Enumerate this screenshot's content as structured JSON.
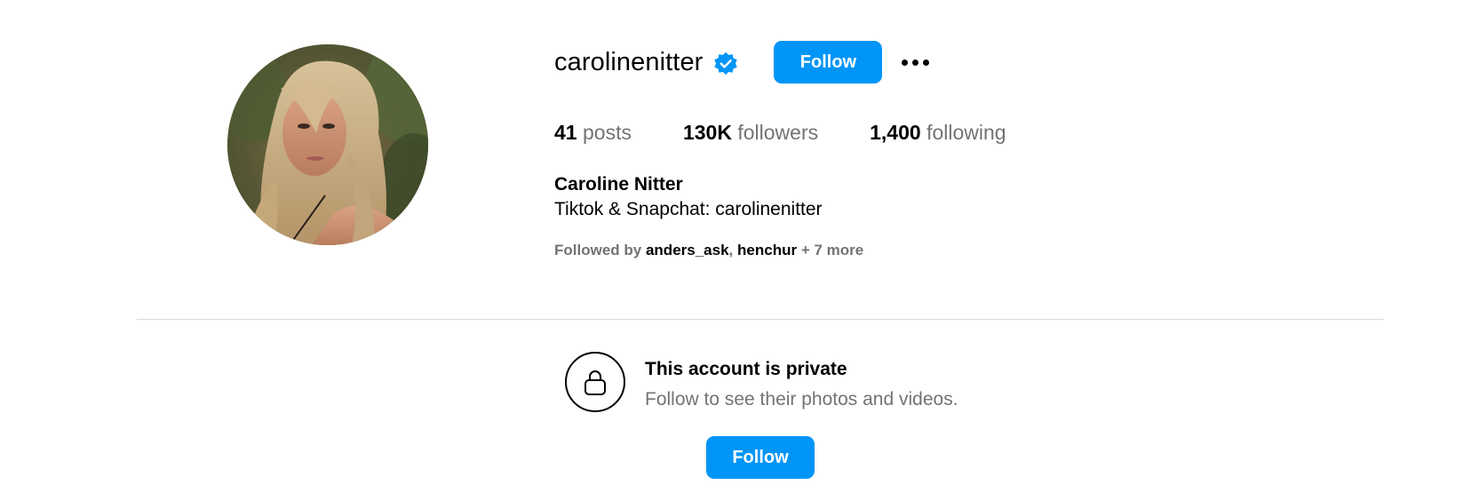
{
  "profile": {
    "username": "carolinenitter",
    "verified": true,
    "follow_label": "Follow",
    "more_icon": "more-horizontal-icon",
    "stats": {
      "posts_count": "41",
      "posts_label": "posts",
      "followers_count": "130K",
      "followers_label": "followers",
      "following_count": "1,400",
      "following_label": "following"
    },
    "full_name": "Caroline Nitter",
    "bio": "Tiktok & Snapchat: carolinenitter",
    "followed_by": {
      "prefix": "Followed by",
      "accounts": [
        "anders_ask",
        "henchur"
      ],
      "separator": ",",
      "suffix": "+ 7 more"
    }
  },
  "private_notice": {
    "icon": "lock-icon",
    "title": "This account is private",
    "subtitle": "Follow to see their photos and videos.",
    "follow_label": "Follow"
  },
  "colors": {
    "accent": "#0095f6",
    "secondary_text": "#737373",
    "divider": "#dbdbdb",
    "verified_badge": "#0095f6"
  }
}
